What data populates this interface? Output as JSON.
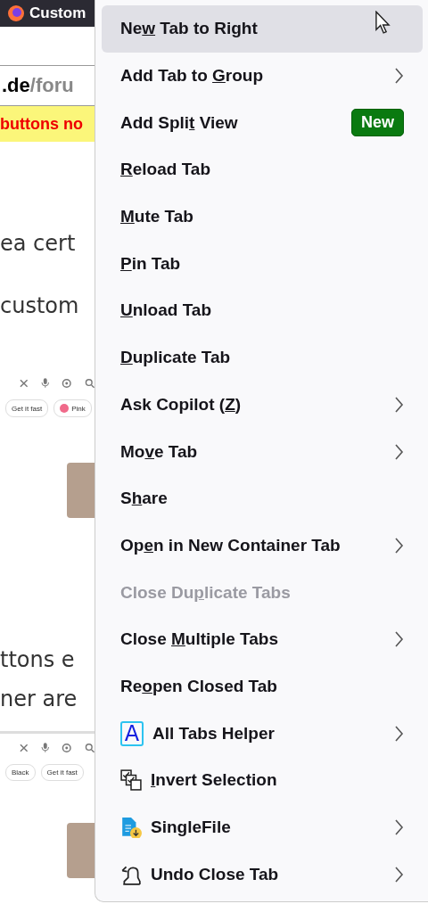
{
  "background_page": {
    "tab_title": "Custom",
    "address_host": ".de",
    "address_path": "/foru",
    "notice": "buttons no",
    "text_lines": [
      "ea cert",
      "custom"
    ],
    "shot_1": {
      "chips": [
        {
          "label": "Get it fast"
        },
        {
          "label": "Pink",
          "color": "#f06a8a"
        }
      ]
    },
    "text_lines_2": [
      "ttons e",
      "ner are"
    ],
    "shot_2": {
      "chips": [
        {
          "label": "Black"
        },
        {
          "label": "Get it fast"
        }
      ]
    }
  },
  "context_menu": {
    "items": [
      {
        "kind": "text",
        "before": "Ne",
        "key": "w",
        "after": " Tab to Right",
        "selected": true,
        "disabled": false,
        "submenu": false
      },
      {
        "kind": "text",
        "before": "Add Tab to ",
        "key": "G",
        "after": "roup",
        "selected": false,
        "disabled": false,
        "submenu": true
      },
      {
        "kind": "text",
        "before": "Add Spli",
        "key": "t",
        "after": " View",
        "selected": false,
        "disabled": false,
        "submenu": false,
        "badge": "New"
      },
      {
        "kind": "text",
        "key": "R",
        "after": "eload Tab",
        "selected": false,
        "disabled": false,
        "submenu": false
      },
      {
        "kind": "text",
        "key": "M",
        "after": "ute Tab",
        "selected": false,
        "disabled": false,
        "submenu": false
      },
      {
        "kind": "text",
        "key": "P",
        "after": "in Tab",
        "selected": false,
        "disabled": false,
        "submenu": false
      },
      {
        "kind": "text",
        "key": "U",
        "after": "nload Tab",
        "selected": false,
        "disabled": false,
        "submenu": false
      },
      {
        "kind": "text",
        "key": "D",
        "after": "uplicate Tab",
        "selected": false,
        "disabled": false,
        "submenu": false
      },
      {
        "kind": "text",
        "before": "Ask Copilot (",
        "key": "Z",
        "after": ")",
        "selected": false,
        "disabled": false,
        "submenu": true
      },
      {
        "kind": "text",
        "before": "Mo",
        "key": "v",
        "after": "e Tab",
        "selected": false,
        "disabled": false,
        "submenu": true
      },
      {
        "kind": "text",
        "before": "S",
        "key": "h",
        "after": "are",
        "selected": false,
        "disabled": false,
        "submenu": false
      },
      {
        "kind": "text",
        "before": "Op",
        "key": "e",
        "after": "n in New Container Tab",
        "selected": false,
        "disabled": false,
        "submenu": true
      },
      {
        "kind": "text",
        "before": "Close Du",
        "key": "p",
        "after": "licate Tabs",
        "selected": false,
        "disabled": true,
        "submenu": false
      },
      {
        "kind": "text",
        "before": "Close ",
        "key": "M",
        "after": "ultiple Tabs",
        "selected": false,
        "disabled": false,
        "submenu": true
      },
      {
        "kind": "text",
        "before": "Re",
        "key": "o",
        "after": "pen Closed Tab",
        "selected": false,
        "disabled": false,
        "submenu": false
      },
      {
        "kind": "letter",
        "before": "All Tabs Helper",
        "selected": false,
        "disabled": false,
        "submenu": true,
        "icon_text": "A"
      },
      {
        "kind": "checkboxes",
        "key": "I",
        "after": "nvert Selection",
        "selected": false,
        "disabled": false,
        "submenu": false
      },
      {
        "kind": "file",
        "before": "SingleFile",
        "selected": false,
        "disabled": false,
        "submenu": true
      },
      {
        "kind": "undo",
        "before": "Undo Close Tab",
        "selected": false,
        "disabled": false,
        "submenu": true
      }
    ]
  }
}
